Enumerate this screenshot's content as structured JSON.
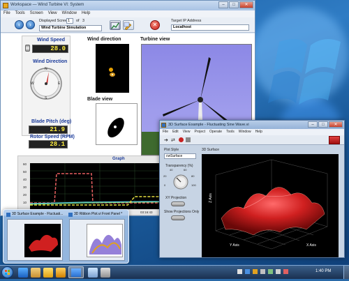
{
  "main_window": {
    "title": "Workspace — Wind Turbine VI: System",
    "menu": [
      "File",
      "Tools",
      "Screen",
      "View",
      "Window",
      "Help"
    ],
    "displayed_screen_label": "Displayed Screen:",
    "screen_index": "1",
    "screen_of": "of",
    "screen_total": "3",
    "screen_name": "Wind Turbine Simulation",
    "target_ip_label": "Target IP Address",
    "target_ip_value": "Localhost",
    "wind_speed_label": "Wind Speed",
    "wind_speed_value": "28.0",
    "wind_direction_label": "Wind Direction",
    "compass": [
      "N",
      "E",
      "S",
      "W"
    ],
    "blade_pitch_label": "Blade Pitch (deg)",
    "blade_pitch_value": "21.9",
    "rotor_speed_label": "Rotor Speed (RPM)",
    "rotor_speed_value": "28.1",
    "wind_direction_view_title": "Wind direction",
    "blade_view_title": "Blade view",
    "turbine_view_title": "Turbine view",
    "graph_title": "Graph",
    "graph_y_ticks": [
      "60",
      "50",
      "40",
      "30",
      "20",
      "10"
    ],
    "graph_x_tick": "03:16:43"
  },
  "surface_window": {
    "title": "3D Surface Example - Fluctuating Sine Wave.vi",
    "menu": [
      "File",
      "Edit",
      "View",
      "Project",
      "Operate",
      "Tools",
      "Window",
      "Help"
    ],
    "plot_style_label": "Plot Style",
    "plot_style_value": "cwSurface",
    "transparency_label": "Transparency (%)",
    "knob_ticks": [
      "0",
      "20",
      "40",
      "60",
      "80",
      "100"
    ],
    "xy_projection_label": "XY Projection",
    "show_projections_label": "Show Projections Only",
    "plot_title": "3D Surface",
    "z_axis": "Z Axis",
    "y_axis": "Y Axis",
    "x_axis": "X Axis"
  },
  "thumbnails": [
    {
      "title": "3D Surface Example - Fluctuati..."
    },
    {
      "title": "3D Ribbon Plot.vi Front Panel *"
    }
  ],
  "taskbar": {
    "clock": "1:40 PM"
  }
}
